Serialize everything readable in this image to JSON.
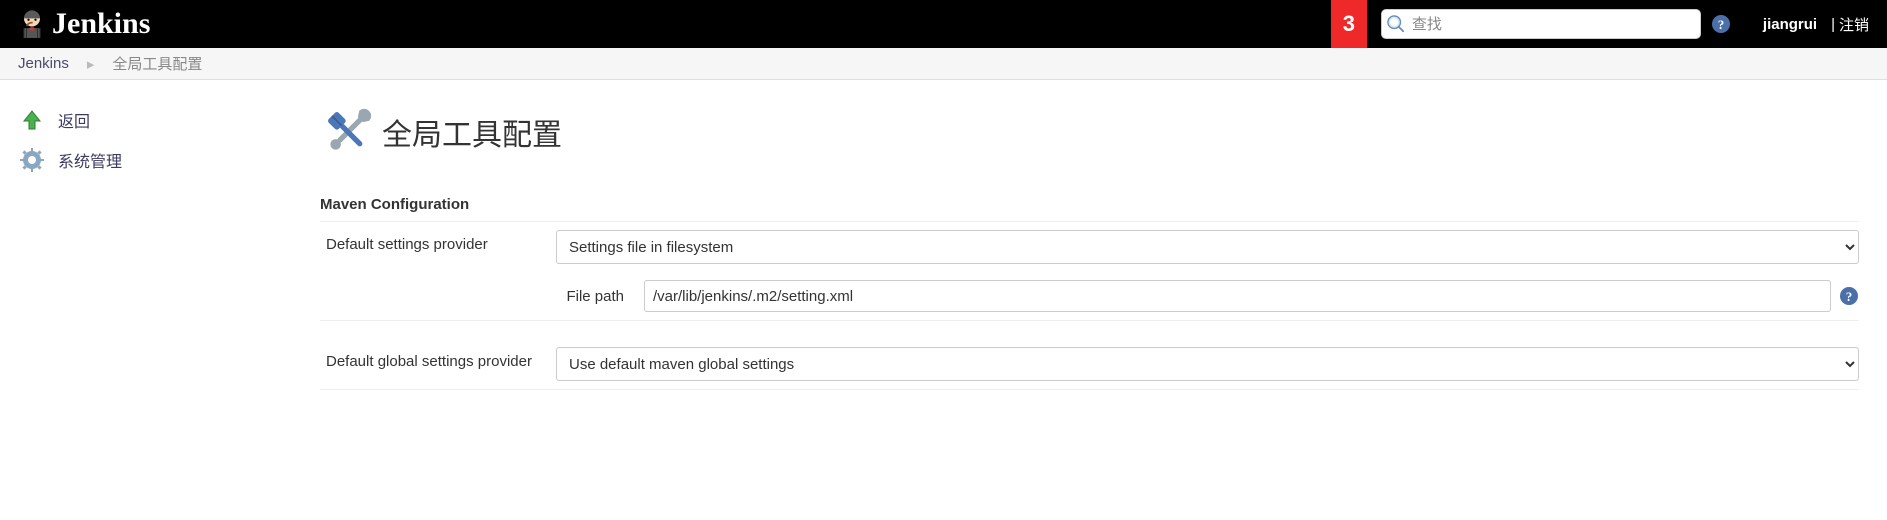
{
  "header": {
    "brand": "Jenkins",
    "notifCount": "3",
    "searchPlaceholder": "查找",
    "user": "jiangrui",
    "logout": "注销"
  },
  "breadcrumbs": {
    "root": "Jenkins",
    "current": "全局工具配置"
  },
  "sidebar": {
    "back": "返回",
    "manage": "系统管理"
  },
  "page": {
    "title": "全局工具配置"
  },
  "maven": {
    "sectionTitle": "Maven Configuration",
    "defaultSettingsLabel": "Default settings provider",
    "defaultSettingsValue": "Settings file in filesystem",
    "filePathLabel": "File path",
    "filePathValue": "/var/lib/jenkins/.m2/setting.xml",
    "defaultGlobalLabel": "Default global settings provider",
    "defaultGlobalValue": "Use default maven global settings"
  }
}
